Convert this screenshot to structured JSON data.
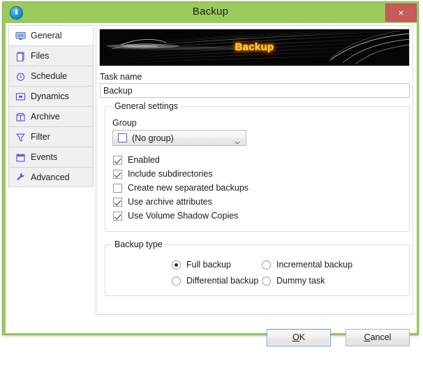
{
  "window": {
    "title": "Backup",
    "title_icon": "app-info-icon",
    "close_label": "×",
    "accent_color": "#9aca5c",
    "close_color": "#c85a5a"
  },
  "sidebar": {
    "items": [
      {
        "label": "General",
        "icon": "monitor-icon",
        "selected": true
      },
      {
        "label": "Files",
        "icon": "file-icon",
        "selected": false
      },
      {
        "label": "Schedule",
        "icon": "clock-icon",
        "selected": false
      },
      {
        "label": "Dynamics",
        "icon": "dynamics-icon",
        "selected": false
      },
      {
        "label": "Archive",
        "icon": "archive-icon",
        "selected": false
      },
      {
        "label": "Filter",
        "icon": "funnel-icon",
        "selected": false
      },
      {
        "label": "Events",
        "icon": "calendar-icon",
        "selected": false
      },
      {
        "label": "Advanced",
        "icon": "wrench-icon",
        "selected": false
      }
    ]
  },
  "banner": {
    "label": "Backup",
    "text_color": "#ffd21a",
    "glow_color": "#ff7b00",
    "background_color": "#050505"
  },
  "task_name": {
    "label": "Task name",
    "value": "Backup",
    "placeholder": "Task name"
  },
  "general_settings": {
    "title": "General settings",
    "group": {
      "label": "Group",
      "value": "(No group)",
      "icon": "group-square-icon",
      "chevron": "chevron-down-icon"
    },
    "checkboxes": [
      {
        "label": "Enabled",
        "checked": true
      },
      {
        "label": "Include subdirectories",
        "checked": true
      },
      {
        "label": "Create new separated backups",
        "checked": false
      },
      {
        "label": "Use archive attributes",
        "checked": true
      },
      {
        "label": "Use Volume Shadow Copies",
        "checked": true
      }
    ]
  },
  "backup_type": {
    "title": "Backup type",
    "options": [
      {
        "label": "Full backup",
        "selected": true
      },
      {
        "label": "Differential backup",
        "selected": false
      },
      {
        "label": "Incremental backup",
        "selected": false
      },
      {
        "label": "Dummy task",
        "selected": false
      }
    ]
  },
  "footer": {
    "ok": {
      "prefix": "",
      "accel": "O",
      "suffix": "K"
    },
    "cancel": {
      "prefix": "",
      "accel": "C",
      "suffix": "ancel"
    }
  }
}
